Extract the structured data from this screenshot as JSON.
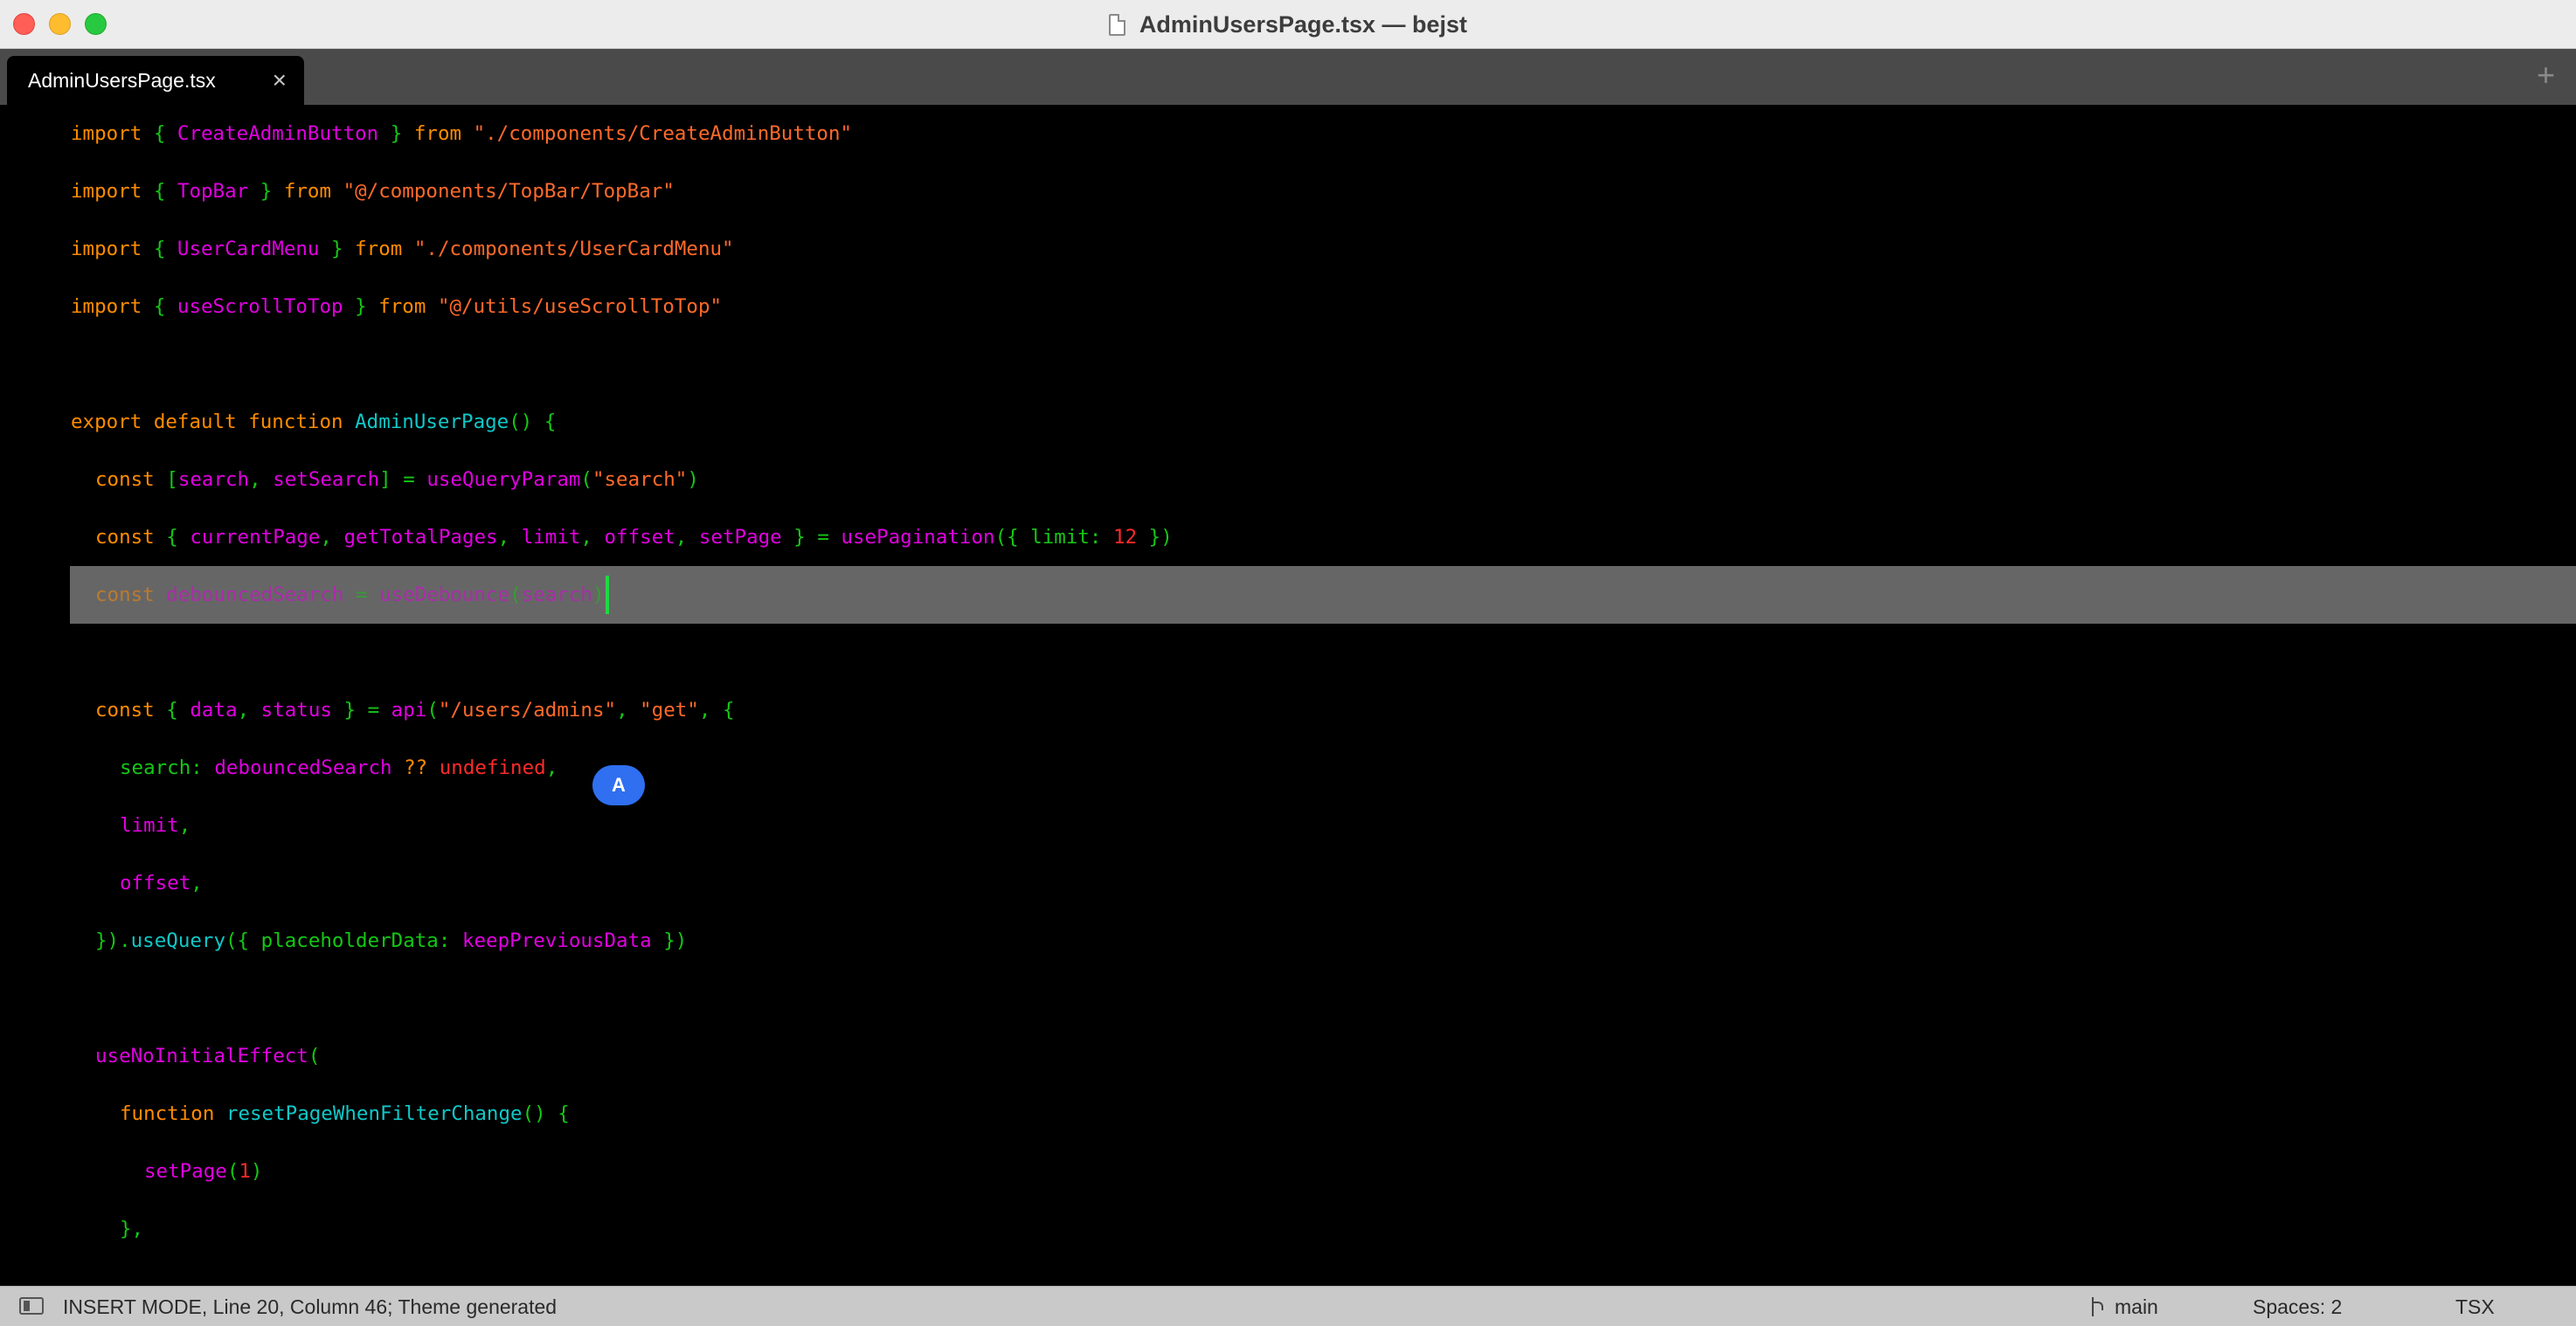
{
  "window": {
    "title": "AdminUsersPage.tsx — bejst",
    "file_icon": "document-icon"
  },
  "tabs": [
    {
      "label": "AdminUsersPage.tsx",
      "close_glyph": "×",
      "active": true
    }
  ],
  "tabbar": {
    "new_tab_glyph": "+"
  },
  "editor": {
    "cursor": {
      "line": 20,
      "column": 46
    },
    "code": {
      "l1": {
        "t1": "import",
        "t2": " { ",
        "t3": "CreateAdminButton",
        "t4": " } ",
        "t5": "from",
        "t6": " ",
        "t7": "\"./components/CreateAdminButton\""
      },
      "l2": {
        "t1": "import",
        "t2": " { ",
        "t3": "TopBar",
        "t4": " } ",
        "t5": "from",
        "t6": " ",
        "t7": "\"@/components/TopBar/TopBar\""
      },
      "l3": {
        "t1": "import",
        "t2": " { ",
        "t3": "UserCardMenu",
        "t4": " } ",
        "t5": "from",
        "t6": " ",
        "t7": "\"./components/UserCardMenu\""
      },
      "l4": {
        "t1": "import",
        "t2": " { ",
        "t3": "useScrollToTop",
        "t4": " } ",
        "t5": "from",
        "t6": " ",
        "t7": "\"@/utils/useScrollToTop\""
      },
      "l5": {
        "t1": "export default function",
        "t2": " ",
        "t3": "AdminUserPage",
        "t4": "() {"
      },
      "l6": {
        "t1": "const",
        "t2": " [",
        "t3": "search",
        "t4": ", ",
        "t5": "setSearch",
        "t6": "] = ",
        "t7": "useQueryParam",
        "t8": "(",
        "t9": "\"search\"",
        "t10": ")"
      },
      "l7": {
        "t1": "const",
        "t2": " { ",
        "t3": "currentPage",
        "t4": ", ",
        "t5": "getTotalPages",
        "t6": ", ",
        "t7": "limit",
        "t8": ", ",
        "t9": "offset",
        "t10": ", ",
        "t11": "setPage",
        "t12": " } = ",
        "t13": "usePagination",
        "t14": "({ limit: ",
        "t15": "12",
        "t16": " })"
      },
      "l8": {
        "t1": "const",
        "t2": " ",
        "t3": "debouncedSearch",
        "t4": " = ",
        "t5": "useDebounce",
        "t6": "(",
        "t7": "search",
        "t8": ")"
      },
      "l9": {
        "t1": "const",
        "t2": " { ",
        "t3": "data",
        "t4": ", ",
        "t5": "status",
        "t6": " } = ",
        "t7": "api",
        "t8": "(",
        "t9": "\"/users/admins\"",
        "t10": ", ",
        "t11": "\"get\"",
        "t12": ", {"
      },
      "l10": {
        "t1": "search: ",
        "t2": "debouncedSearch",
        "t3": " ?? ",
        "t4": "undefined",
        "t5": ","
      },
      "l11": {
        "t1": "limit",
        "t2": ","
      },
      "l12": {
        "t1": "offset",
        "t2": ","
      },
      "l13": {
        "t1": "}).",
        "t2": "useQuery",
        "t3": "({ placeholderData: ",
        "t4": "keepPreviousData",
        "t5": " })"
      },
      "l14": {
        "t1": "useNoInitialEffect",
        "t2": "("
      },
      "l15": {
        "t1": "function",
        "t2": " ",
        "t3": "resetPageWhenFilterChange",
        "t4": "() {"
      },
      "l16": {
        "t1": "setPage",
        "t2": "(",
        "t3": "1",
        "t4": ")"
      },
      "l17": {
        "t1": "},"
      }
    }
  },
  "collaborator": {
    "initial": "A",
    "color": "#2f6ff0"
  },
  "statusbar": {
    "sidebar_toggle_icon": "sidebar-toggle-icon",
    "mode_text": "INSERT MODE, Line 20, Column 46; Theme generated",
    "branch_icon": "git-branch-icon",
    "branch": "main",
    "indentation": "Spaces: 2",
    "syntax": "TSX"
  },
  "colors": {
    "keyword": "#ff8c00",
    "punctuation": "#14c814",
    "string": "#ff6a2a",
    "function": "#e000e0",
    "type_function": "#10c8c8",
    "number": "#ff2a2a",
    "caret": "#20d940",
    "selection_line": "#666666"
  }
}
